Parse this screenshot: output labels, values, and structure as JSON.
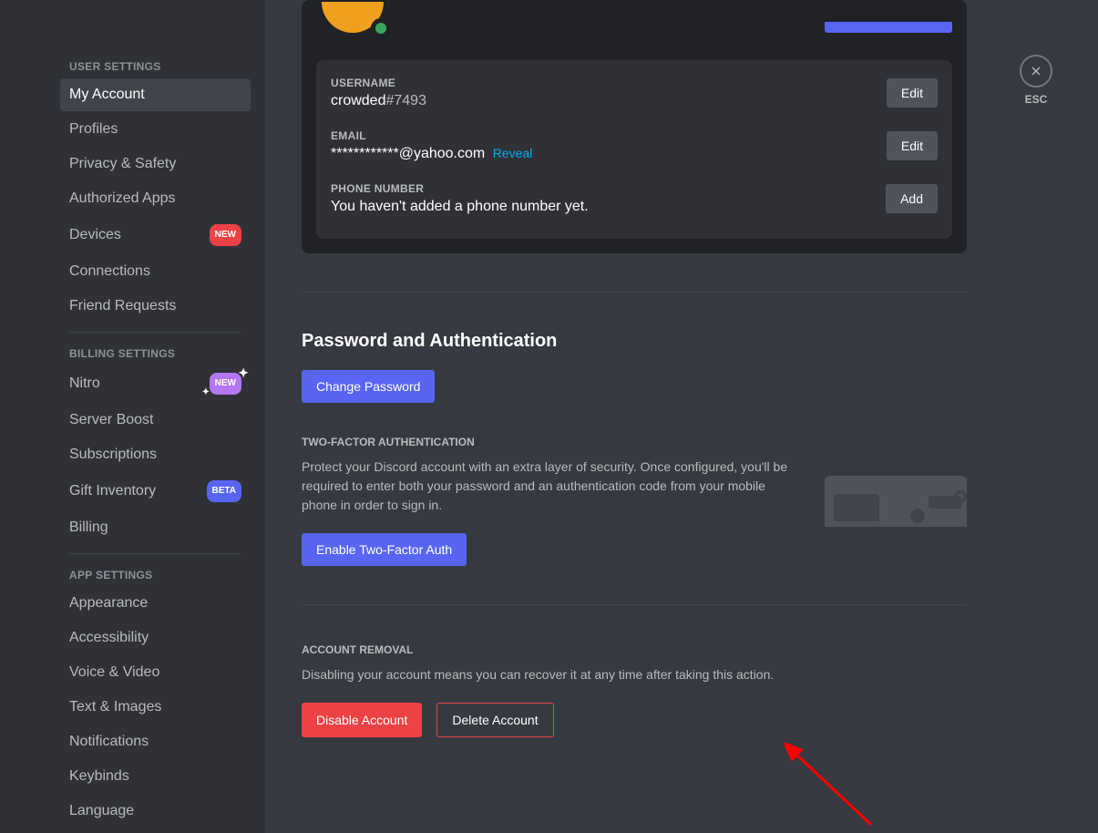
{
  "close": {
    "label": "ESC"
  },
  "sidebar": {
    "sections": {
      "user": {
        "header": "USER SETTINGS",
        "items": [
          "My Account",
          "Profiles",
          "Privacy & Safety",
          "Authorized Apps",
          "Devices",
          "Connections",
          "Friend Requests"
        ],
        "devices_badge": "NEW"
      },
      "billing": {
        "header": "BILLING SETTINGS",
        "items": [
          "Nitro",
          "Server Boost",
          "Subscriptions",
          "Gift Inventory",
          "Billing"
        ],
        "nitro_badge": "NEW",
        "gift_badge": "BETA"
      },
      "app": {
        "header": "APP SETTINGS",
        "items": [
          "Appearance",
          "Accessibility",
          "Voice & Video",
          "Text & Images",
          "Notifications",
          "Keybinds",
          "Language"
        ]
      }
    }
  },
  "account": {
    "username_label": "USERNAME",
    "username": "crowded",
    "discriminator": "#7493",
    "email_label": "EMAIL",
    "email_masked": "************@yahoo.com",
    "reveal": "Reveal",
    "phone_label": "PHONE NUMBER",
    "phone_value": "You haven't added a phone number yet.",
    "edit": "Edit",
    "add": "Add"
  },
  "password_section": {
    "title": "Password and Authentication",
    "change_password": "Change Password",
    "twofa_header": "TWO-FACTOR AUTHENTICATION",
    "twofa_desc": "Protect your Discord account with an extra layer of security. Once configured, you'll be required to enter both your password and an authentication code from your mobile phone in order to sign in.",
    "enable_twofa": "Enable Two-Factor Auth"
  },
  "removal_section": {
    "header": "ACCOUNT REMOVAL",
    "desc": "Disabling your account means you can recover it at any time after taking this action.",
    "disable": "Disable Account",
    "delete": "Delete Account"
  }
}
